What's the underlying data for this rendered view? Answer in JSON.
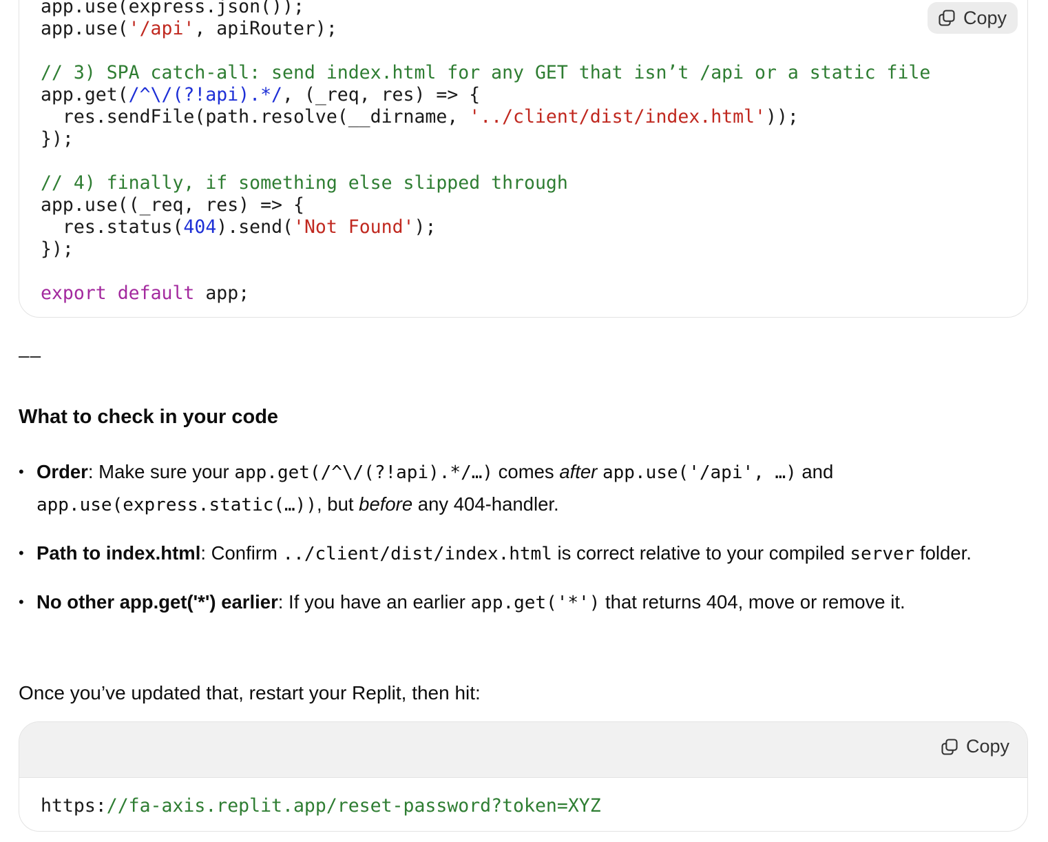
{
  "code_block_1": {
    "copy_label": "Copy",
    "lines": [
      [
        {
          "t": "plain",
          "v": "app.use(express.json());"
        }
      ],
      [
        {
          "t": "plain",
          "v": "app.use("
        },
        {
          "t": "string",
          "v": "'/api'"
        },
        {
          "t": "plain",
          "v": ", apiRouter);"
        }
      ],
      [
        {
          "t": "plain",
          "v": ""
        }
      ],
      [
        {
          "t": "comment",
          "v": "// 3) SPA catch-all: send index.html for any GET that isn’t /api or a static file"
        }
      ],
      [
        {
          "t": "plain",
          "v": "app.get("
        },
        {
          "t": "regex",
          "v": "/^\\/(?!api).*/"
        },
        {
          "t": "plain",
          "v": ", (_req, res) => {"
        }
      ],
      [
        {
          "t": "plain",
          "v": "  res.sendFile(path.resolve(__dirname, "
        },
        {
          "t": "string",
          "v": "'../client/dist/index.html'"
        },
        {
          "t": "plain",
          "v": "));"
        }
      ],
      [
        {
          "t": "plain",
          "v": "});"
        }
      ],
      [
        {
          "t": "plain",
          "v": ""
        }
      ],
      [
        {
          "t": "comment",
          "v": "// 4) finally, if something else slipped through"
        }
      ],
      [
        {
          "t": "plain",
          "v": "app.use((_req, res) => {"
        }
      ],
      [
        {
          "t": "plain",
          "v": "  res.status("
        },
        {
          "t": "number",
          "v": "404"
        },
        {
          "t": "plain",
          "v": ").send("
        },
        {
          "t": "string",
          "v": "'Not Found'"
        },
        {
          "t": "plain",
          "v": ");"
        }
      ],
      [
        {
          "t": "plain",
          "v": "});"
        }
      ],
      [
        {
          "t": "plain",
          "v": ""
        }
      ],
      [
        {
          "t": "keyword",
          "v": "export"
        },
        {
          "t": "plain",
          "v": " "
        },
        {
          "t": "keyword",
          "v": "default"
        },
        {
          "t": "plain",
          "v": " app;"
        }
      ]
    ]
  },
  "separator": "––",
  "heading": "What to check in your code",
  "bullets": [
    {
      "parts": [
        {
          "t": "strong",
          "v": "Order"
        },
        {
          "t": "text",
          "v": ": Make sure your "
        },
        {
          "t": "code",
          "v": "app.get(/^\\/(?!api).*/…)"
        },
        {
          "t": "text",
          "v": " comes "
        },
        {
          "t": "em",
          "v": "after"
        },
        {
          "t": "text",
          "v": " "
        },
        {
          "t": "code",
          "v": "app.use('/api', …)"
        },
        {
          "t": "text",
          "v": " and "
        },
        {
          "t": "code",
          "v": "app.use(express.static(…))"
        },
        {
          "t": "text",
          "v": ", but "
        },
        {
          "t": "em",
          "v": "before"
        },
        {
          "t": "text",
          "v": " any 404-handler."
        }
      ]
    },
    {
      "parts": [
        {
          "t": "strong",
          "v": "Path to index.html"
        },
        {
          "t": "text",
          "v": ": Confirm "
        },
        {
          "t": "code",
          "v": "../client/dist/index.html"
        },
        {
          "t": "text",
          "v": " is correct relative to your compiled "
        },
        {
          "t": "code",
          "v": "server"
        },
        {
          "t": "text",
          "v": " folder."
        }
      ]
    },
    {
      "parts": [
        {
          "t": "strong",
          "v": "No other app.get('*') earlier"
        },
        {
          "t": "text",
          "v": ": If you have an earlier "
        },
        {
          "t": "code",
          "v": "app.get('*')"
        },
        {
          "t": "text",
          "v": " that returns 404, move or remove it."
        }
      ]
    }
  ],
  "paragraph": "Once you’ve updated that, restart your Replit, then hit:",
  "code_block_2": {
    "copy_label": "Copy",
    "url_scheme": "https:",
    "url_rest": "//fa-axis.replit.app/reset-password?token=XYZ"
  },
  "colors": {
    "comment": "#2e7d32",
    "string": "#c0281f",
    "regex": "#1d2fd6",
    "keyword": "#a3299e"
  }
}
